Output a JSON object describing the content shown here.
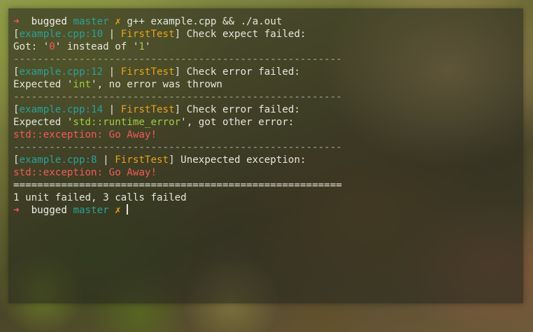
{
  "prompt": {
    "arrow": "➜",
    "directory": "bugged",
    "branch": "master",
    "dirty_mark": "✗"
  },
  "command": "g++ example.cpp && ./a.out",
  "blocks": [
    {
      "open": "[",
      "file": "example.cpp:10",
      "pipe": " | ",
      "test": "FirstTest",
      "close": "]",
      "message": " Check expect failed:",
      "detail": {
        "pre": "Got: '",
        "got": "0",
        "mid": "' instead of '",
        "expected": "1",
        "post": "'"
      }
    },
    {
      "open": "[",
      "file": "example.cpp:12",
      "pipe": " | ",
      "test": "FirstTest",
      "close": "]",
      "message": " Check error failed:",
      "detail": {
        "pre": "Expected '",
        "type": "int",
        "post": "', no error was thrown"
      }
    },
    {
      "open": "[",
      "file": "example.cpp:14",
      "pipe": " | ",
      "test": "FirstTest",
      "close": "]",
      "message": " Check error failed:",
      "detail": {
        "pre": "Expected '",
        "type": "std::runtime_error",
        "post": "', got other error:"
      },
      "error_line": "std::exception: Go Away!"
    },
    {
      "open": "[",
      "file": "example.cpp:8",
      "pipe": " | ",
      "test": "FirstTest",
      "close": "]",
      "message": " Unexpected exception:",
      "error_line": "std::exception: Go Away!"
    }
  ],
  "separator_dash": "-------------------------------------------------------",
  "separator_equals": "=======================================================",
  "summary": "1 unit failed, 3 calls failed"
}
